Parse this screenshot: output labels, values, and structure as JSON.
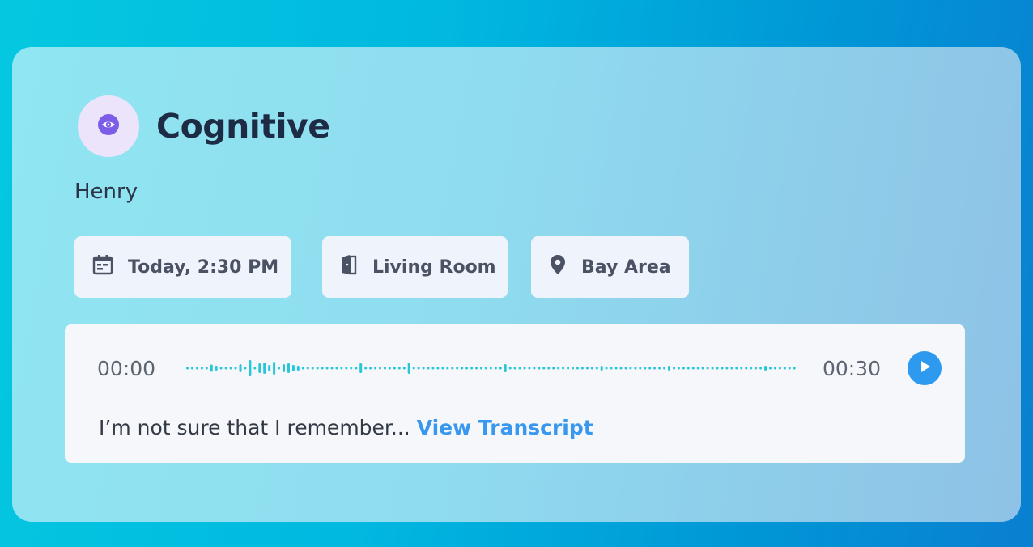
{
  "card": {
    "title": "Cognitive",
    "subject": "Henry",
    "icon": "eye-icon",
    "accent_color": "#7b5de8",
    "chips": [
      {
        "label": "Today, 2:30 PM",
        "icon": "calendar-icon"
      },
      {
        "label": "Living Room",
        "icon": "door-icon"
      },
      {
        "label": "Bay Area",
        "icon": "location-pin-icon"
      }
    ]
  },
  "player": {
    "start_time": "00:00",
    "end_time": "00:30",
    "progress": 0,
    "play_icon": "play-icon",
    "wave_color": "#27c6d9",
    "play_color": "#2d9af0",
    "transcript_preview": "I’m not sure that I remember...",
    "view_transcript_label": "View Transcript",
    "link_color": "#3897ee"
  }
}
